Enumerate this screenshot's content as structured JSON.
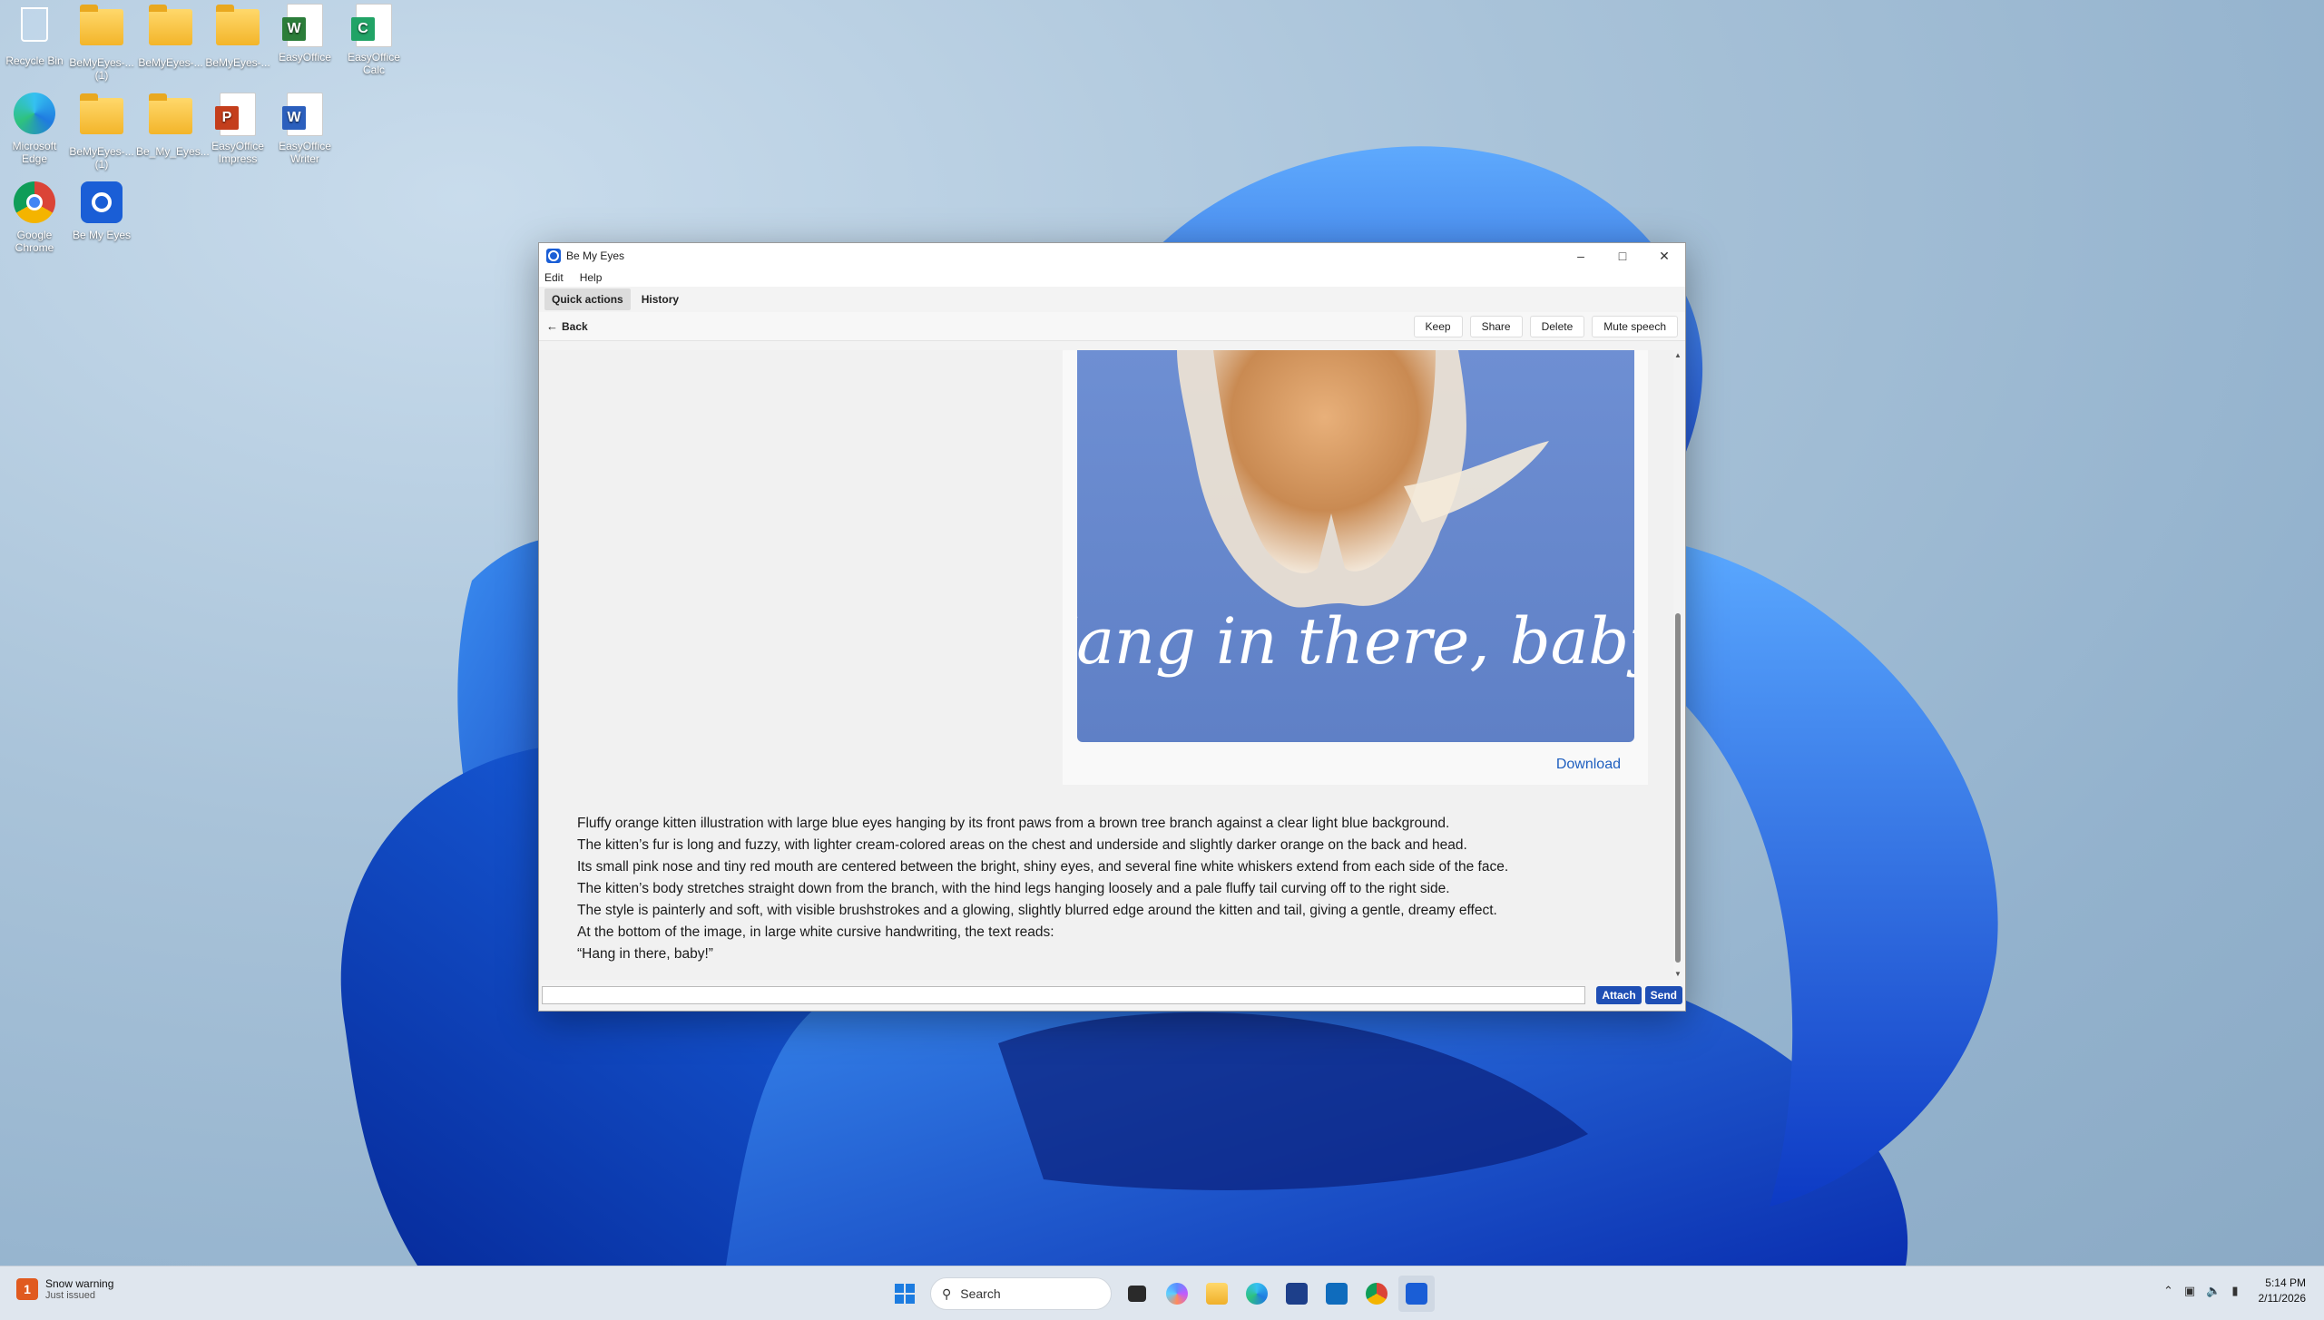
{
  "desktop": {
    "icons": [
      {
        "label": "Recycle Bin"
      },
      {
        "label": "BeMyEyes-...\n(1)"
      },
      {
        "label": "BeMyEyes-..."
      },
      {
        "label": "BeMyEyes-..."
      },
      {
        "label": "EasyOffice"
      },
      {
        "label": "EasyOffice\nCalc"
      },
      {
        "label": "Microsoft\nEdge"
      },
      {
        "label": "BeMyEyes-...\n(1)"
      },
      {
        "label": "Be_My_Eyes..."
      },
      {
        "label": "EasyOffice\nImpress"
      },
      {
        "label": "EasyOffice\nWriter"
      },
      {
        "label": "Google\nChrome"
      },
      {
        "label": "Be My Eyes"
      }
    ]
  },
  "window": {
    "title": "Be My Eyes",
    "menu": [
      "Edit",
      "Help"
    ],
    "tabs": [
      {
        "label": "Quick actions",
        "active": true
      },
      {
        "label": "History",
        "active": false
      }
    ],
    "back_label": "Back",
    "toolbar_buttons": [
      "Keep",
      "Share",
      "Delete",
      "Mute speech"
    ],
    "image_caption": "Hang in there, baby!",
    "download_label": "Download",
    "description_lines": [
      "Fluffy orange kitten illustration with large blue eyes hanging by its front paws from a brown tree branch against a clear light blue background.",
      "The kitten’s fur is long and fuzzy, with lighter cream-colored areas on the chest and underside and slightly darker orange on the back and head.",
      "Its small pink nose and tiny red mouth are centered between the bright, shiny eyes, and several fine white whiskers extend from each side of the face.",
      "The kitten’s body stretches straight down from the branch, with the hind legs hanging loosely and a pale fluffy tail curving off to the right side.",
      "The style is painterly and soft, with visible brushstrokes and a glowing, slightly blurred edge around the kitten and tail, giving a gentle, dreamy effect.",
      "At the bottom of the image, in large white cursive handwriting, the text reads:",
      "“Hang in there, baby!”"
    ],
    "input_value": "",
    "attach_label": "Attach",
    "send_label": "Send"
  },
  "taskbar": {
    "weather_title": "Snow warning",
    "weather_sub": "Just issued",
    "weather_badge": "1",
    "search_placeholder": "Search",
    "time": "5:14 PM",
    "date": "2/11/2026"
  },
  "colors": {
    "accent": "#1f4fb5",
    "link": "#1f5fbf",
    "image_bg": "#6d8fcf"
  }
}
